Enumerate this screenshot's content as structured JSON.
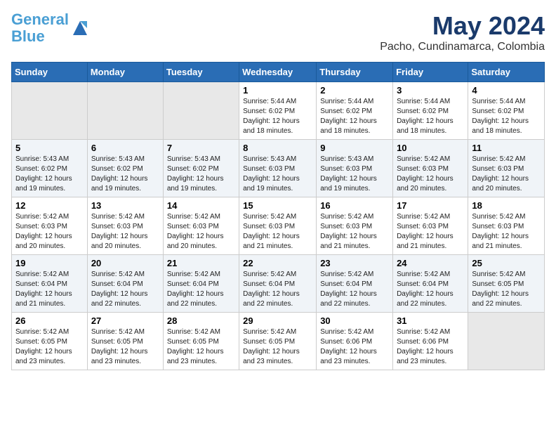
{
  "logo": {
    "line1": "General",
    "line2": "Blue"
  },
  "title": "May 2024",
  "subtitle": "Pacho, Cundinamarca, Colombia",
  "days_of_week": [
    "Sunday",
    "Monday",
    "Tuesday",
    "Wednesday",
    "Thursday",
    "Friday",
    "Saturday"
  ],
  "weeks": [
    [
      {
        "day": "",
        "info": ""
      },
      {
        "day": "",
        "info": ""
      },
      {
        "day": "",
        "info": ""
      },
      {
        "day": "1",
        "info": "Sunrise: 5:44 AM\nSunset: 6:02 PM\nDaylight: 12 hours and 18 minutes."
      },
      {
        "day": "2",
        "info": "Sunrise: 5:44 AM\nSunset: 6:02 PM\nDaylight: 12 hours and 18 minutes."
      },
      {
        "day": "3",
        "info": "Sunrise: 5:44 AM\nSunset: 6:02 PM\nDaylight: 12 hours and 18 minutes."
      },
      {
        "day": "4",
        "info": "Sunrise: 5:44 AM\nSunset: 6:02 PM\nDaylight: 12 hours and 18 minutes."
      }
    ],
    [
      {
        "day": "5",
        "info": "Sunrise: 5:43 AM\nSunset: 6:02 PM\nDaylight: 12 hours and 19 minutes."
      },
      {
        "day": "6",
        "info": "Sunrise: 5:43 AM\nSunset: 6:02 PM\nDaylight: 12 hours and 19 minutes."
      },
      {
        "day": "7",
        "info": "Sunrise: 5:43 AM\nSunset: 6:02 PM\nDaylight: 12 hours and 19 minutes."
      },
      {
        "day": "8",
        "info": "Sunrise: 5:43 AM\nSunset: 6:03 PM\nDaylight: 12 hours and 19 minutes."
      },
      {
        "day": "9",
        "info": "Sunrise: 5:43 AM\nSunset: 6:03 PM\nDaylight: 12 hours and 19 minutes."
      },
      {
        "day": "10",
        "info": "Sunrise: 5:42 AM\nSunset: 6:03 PM\nDaylight: 12 hours and 20 minutes."
      },
      {
        "day": "11",
        "info": "Sunrise: 5:42 AM\nSunset: 6:03 PM\nDaylight: 12 hours and 20 minutes."
      }
    ],
    [
      {
        "day": "12",
        "info": "Sunrise: 5:42 AM\nSunset: 6:03 PM\nDaylight: 12 hours and 20 minutes."
      },
      {
        "day": "13",
        "info": "Sunrise: 5:42 AM\nSunset: 6:03 PM\nDaylight: 12 hours and 20 minutes."
      },
      {
        "day": "14",
        "info": "Sunrise: 5:42 AM\nSunset: 6:03 PM\nDaylight: 12 hours and 20 minutes."
      },
      {
        "day": "15",
        "info": "Sunrise: 5:42 AM\nSunset: 6:03 PM\nDaylight: 12 hours and 21 minutes."
      },
      {
        "day": "16",
        "info": "Sunrise: 5:42 AM\nSunset: 6:03 PM\nDaylight: 12 hours and 21 minutes."
      },
      {
        "day": "17",
        "info": "Sunrise: 5:42 AM\nSunset: 6:03 PM\nDaylight: 12 hours and 21 minutes."
      },
      {
        "day": "18",
        "info": "Sunrise: 5:42 AM\nSunset: 6:03 PM\nDaylight: 12 hours and 21 minutes."
      }
    ],
    [
      {
        "day": "19",
        "info": "Sunrise: 5:42 AM\nSunset: 6:04 PM\nDaylight: 12 hours and 21 minutes."
      },
      {
        "day": "20",
        "info": "Sunrise: 5:42 AM\nSunset: 6:04 PM\nDaylight: 12 hours and 22 minutes."
      },
      {
        "day": "21",
        "info": "Sunrise: 5:42 AM\nSunset: 6:04 PM\nDaylight: 12 hours and 22 minutes."
      },
      {
        "day": "22",
        "info": "Sunrise: 5:42 AM\nSunset: 6:04 PM\nDaylight: 12 hours and 22 minutes."
      },
      {
        "day": "23",
        "info": "Sunrise: 5:42 AM\nSunset: 6:04 PM\nDaylight: 12 hours and 22 minutes."
      },
      {
        "day": "24",
        "info": "Sunrise: 5:42 AM\nSunset: 6:04 PM\nDaylight: 12 hours and 22 minutes."
      },
      {
        "day": "25",
        "info": "Sunrise: 5:42 AM\nSunset: 6:05 PM\nDaylight: 12 hours and 22 minutes."
      }
    ],
    [
      {
        "day": "26",
        "info": "Sunrise: 5:42 AM\nSunset: 6:05 PM\nDaylight: 12 hours and 23 minutes."
      },
      {
        "day": "27",
        "info": "Sunrise: 5:42 AM\nSunset: 6:05 PM\nDaylight: 12 hours and 23 minutes."
      },
      {
        "day": "28",
        "info": "Sunrise: 5:42 AM\nSunset: 6:05 PM\nDaylight: 12 hours and 23 minutes."
      },
      {
        "day": "29",
        "info": "Sunrise: 5:42 AM\nSunset: 6:05 PM\nDaylight: 12 hours and 23 minutes."
      },
      {
        "day": "30",
        "info": "Sunrise: 5:42 AM\nSunset: 6:06 PM\nDaylight: 12 hours and 23 minutes."
      },
      {
        "day": "31",
        "info": "Sunrise: 5:42 AM\nSunset: 6:06 PM\nDaylight: 12 hours and 23 minutes."
      },
      {
        "day": "",
        "info": ""
      }
    ]
  ]
}
